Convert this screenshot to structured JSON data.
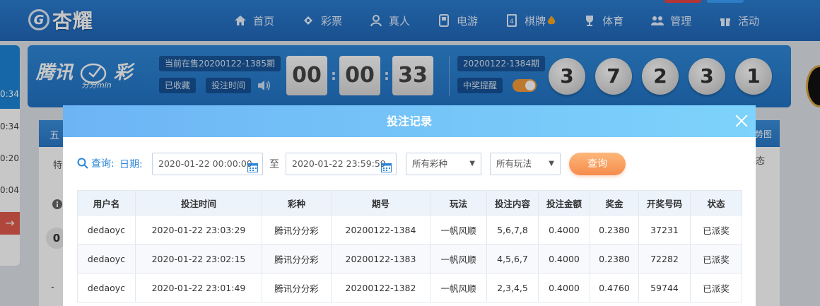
{
  "brand": {
    "logo_mark": "G",
    "logo_text": "杏耀"
  },
  "nav": [
    {
      "label": "首页",
      "icon": "home-icon"
    },
    {
      "label": "彩票",
      "icon": "ticket-icon"
    },
    {
      "label": "真人",
      "icon": "person-icon"
    },
    {
      "label": "电游",
      "icon": "arcade-icon"
    },
    {
      "label": "棋牌",
      "icon": "cards-icon"
    },
    {
      "label": "体育",
      "icon": "trophy-icon"
    },
    {
      "label": "管理",
      "icon": "users-icon"
    },
    {
      "label": "活动",
      "icon": "gift-icon"
    }
  ],
  "left_strip": {
    "times": [
      "0:34",
      "0:34",
      "0:20",
      "0:04"
    ],
    "arrow": "→"
  },
  "lottery": {
    "logo_text": "腾讯",
    "logo_text2": "彩",
    "logo_sub": "分分min",
    "current_issue": "当前在售20200122-1385期",
    "favorite_label": "已收藏",
    "bet_time_label": "投注时间",
    "countdown": [
      "00",
      "00",
      "33"
    ],
    "last_issue": "20200122-1384期",
    "win_remind_label": "中奖提醒",
    "balls": [
      "3",
      "7",
      "2",
      "3",
      "1"
    ]
  },
  "background": {
    "tab_fragment": "五",
    "row_fragment": "特",
    "right_fragment": "势图",
    "right_fragment2": "态",
    "circle": "0",
    "dash": "-"
  },
  "modal": {
    "title": "投注记录",
    "query_label": "查询:",
    "date_label": "日期:",
    "date_from": "2020-01-22 00:00:00",
    "date_to": "2020-01-22 23:59:59",
    "to_label": "至",
    "lottery_select": "所有彩种",
    "play_select": "所有玩法",
    "query_button": "查询",
    "columns": [
      "用户名",
      "投注时间",
      "彩种",
      "期号",
      "玩法",
      "投注内容",
      "投注金额",
      "奖金",
      "开奖号码",
      "状态"
    ],
    "rows": [
      [
        "dedaoyc",
        "2020-01-22 23:03:29",
        "腾讯分分彩",
        "20200122-1384",
        "一帆风顺",
        "5,6,7,8",
        "0.4000",
        "0.2380",
        "37231",
        "已派奖"
      ],
      [
        "dedaoyc",
        "2020-01-22 23:02:15",
        "腾讯分分彩",
        "20200122-1383",
        "一帆风顺",
        "4,5,6,7",
        "0.4000",
        "0.2380",
        "72282",
        "已派奖"
      ],
      [
        "dedaoyc",
        "2020-01-22 23:01:49",
        "腾讯分分彩",
        "20200122-1382",
        "一帆风顺",
        "2,3,4,5",
        "0.4000",
        "0.4760",
        "59744",
        "已派奖"
      ]
    ]
  }
}
